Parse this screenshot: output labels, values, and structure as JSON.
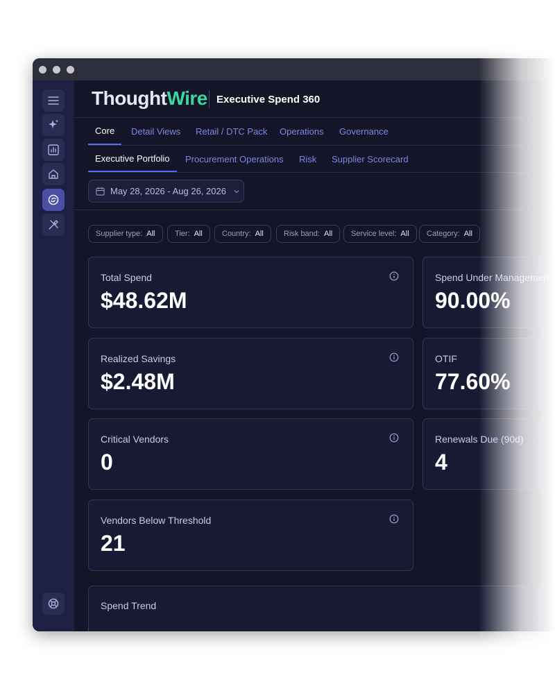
{
  "brand": {
    "logo_part1": "Thought",
    "logo_part2": "Wire",
    "app_title": "Executive Spend 360"
  },
  "rail": {
    "items": [
      {
        "icon": "menu-icon"
      },
      {
        "icon": "sparkle-icon"
      },
      {
        "icon": "chart-icon"
      },
      {
        "icon": "home-icon"
      },
      {
        "icon": "spend-cycle-icon",
        "active": true
      },
      {
        "icon": "tools-icon"
      }
    ],
    "bottom_icon": "support-icon"
  },
  "primary_tabs": [
    "Core",
    "Detail Views",
    "Retail / DTC Pack",
    "Operations",
    "Governance"
  ],
  "secondary_tabs": [
    "Executive Portfolio",
    "Procurement Operations",
    "Risk",
    "Supplier Scorecard"
  ],
  "date_range": "May 28, 2026 - Aug 26, 2026",
  "filters": [
    {
      "label": "Supplier type:",
      "value": "All"
    },
    {
      "label": "Tier:",
      "value": "All"
    },
    {
      "label": "Country:",
      "value": "All"
    },
    {
      "label": "Risk band:",
      "value": "All"
    },
    {
      "label": "Service level:",
      "value": "All"
    },
    {
      "label": "Category:",
      "value": "All"
    }
  ],
  "kpis": [
    {
      "label": "Total Spend",
      "value": "$48.62M"
    },
    {
      "label": "Spend Under Management",
      "value": "90.00%"
    },
    {
      "label": "Realized Savings",
      "value": "$2.48M"
    },
    {
      "label": "OTIF",
      "value": "77.60%"
    },
    {
      "label": "Critical Vendors",
      "value": "0"
    },
    {
      "label": "Renewals Due (90d)",
      "value": "4"
    },
    {
      "label": "Vendors Below Threshold",
      "value": "21"
    }
  ],
  "trend_card": {
    "title": "Spend Trend"
  },
  "colors": {
    "background": "#141528",
    "rail": "#1d1f44",
    "accent": "#5a6bf0",
    "logo_accent": "#3ad6a0"
  }
}
